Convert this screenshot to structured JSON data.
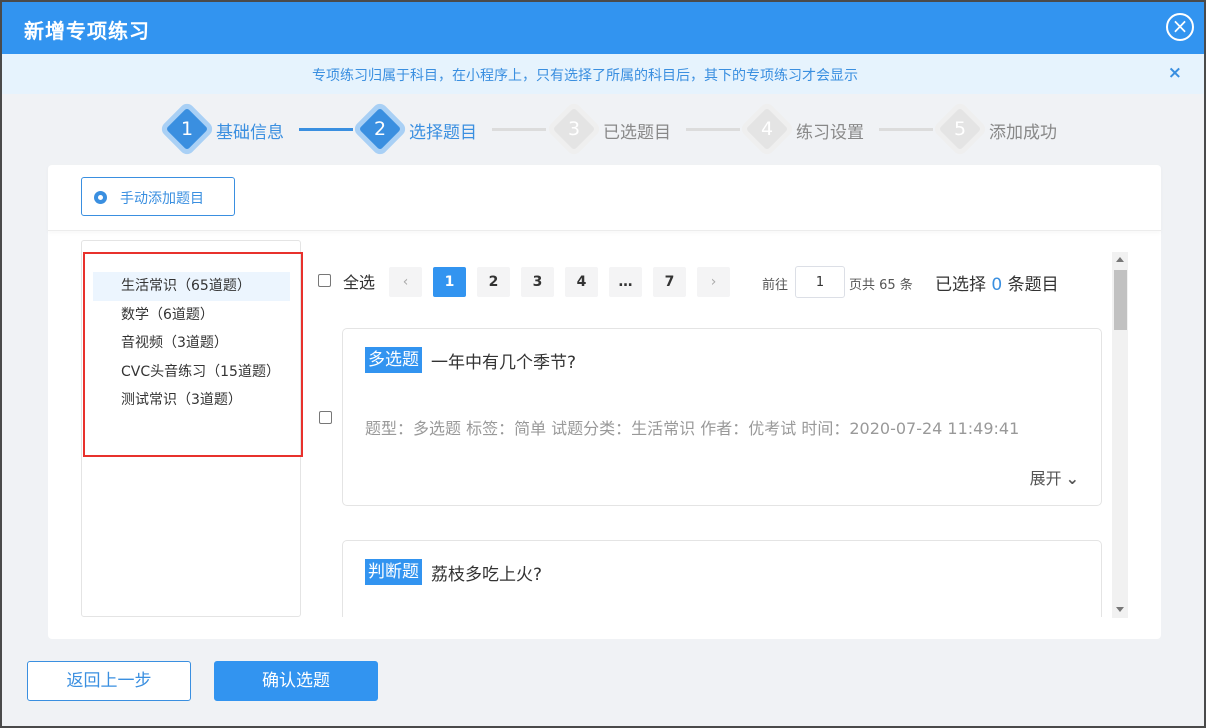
{
  "dialog": {
    "title": "新增专项练习",
    "close_icon": "close-circle-icon"
  },
  "notice": {
    "text": "专项练习归属于科目，在小程序上，只有选择了所属的科目后，其下的专项练习才会显示",
    "close_label": "×"
  },
  "steps": [
    {
      "num": "1",
      "label": "基础信息",
      "state": "done"
    },
    {
      "num": "2",
      "label": "选择题目",
      "state": "active"
    },
    {
      "num": "3",
      "label": "已选题目",
      "state": "pending"
    },
    {
      "num": "4",
      "label": "练习设置",
      "state": "pending"
    },
    {
      "num": "5",
      "label": "添加成功",
      "state": "pending"
    }
  ],
  "manual_add": {
    "label": "手动添加题目"
  },
  "categories": [
    {
      "label": "生活常识（65道题）",
      "selected": true
    },
    {
      "label": "数学（6道题）",
      "selected": false
    },
    {
      "label": "音视频（3道题）",
      "selected": false
    },
    {
      "label": "CVC头音练习（15道题）",
      "selected": false
    },
    {
      "label": "测试常识（3道题）",
      "selected": false
    }
  ],
  "toolbar": {
    "select_all": "全选",
    "prev": "‹",
    "next": "›",
    "pages": [
      "1",
      "2",
      "3",
      "4",
      "…",
      "7"
    ],
    "current_page": "1",
    "goto_label": "前往",
    "goto_value": "1",
    "total_text": "页共 65 条",
    "selected_prefix": "已选择",
    "selected_count": "0",
    "selected_suffix": "条题目"
  },
  "questions": [
    {
      "type": "多选题",
      "text": "一年中有几个季节?",
      "meta": "题型：多选题    标签：简单    试题分类：生活常识    作者：优考试    时间：2020-07-24 11:49:41",
      "expand": "展开"
    },
    {
      "type": "判断题",
      "text": "荔枝多吃上火?",
      "meta": "",
      "expand": ""
    }
  ],
  "footer": {
    "back": "返回上一步",
    "confirm": "确认选题"
  },
  "colors": {
    "primary": "#3294f0",
    "highlight_border": "#e8312c",
    "notice_bg": "#e6f3fd"
  }
}
